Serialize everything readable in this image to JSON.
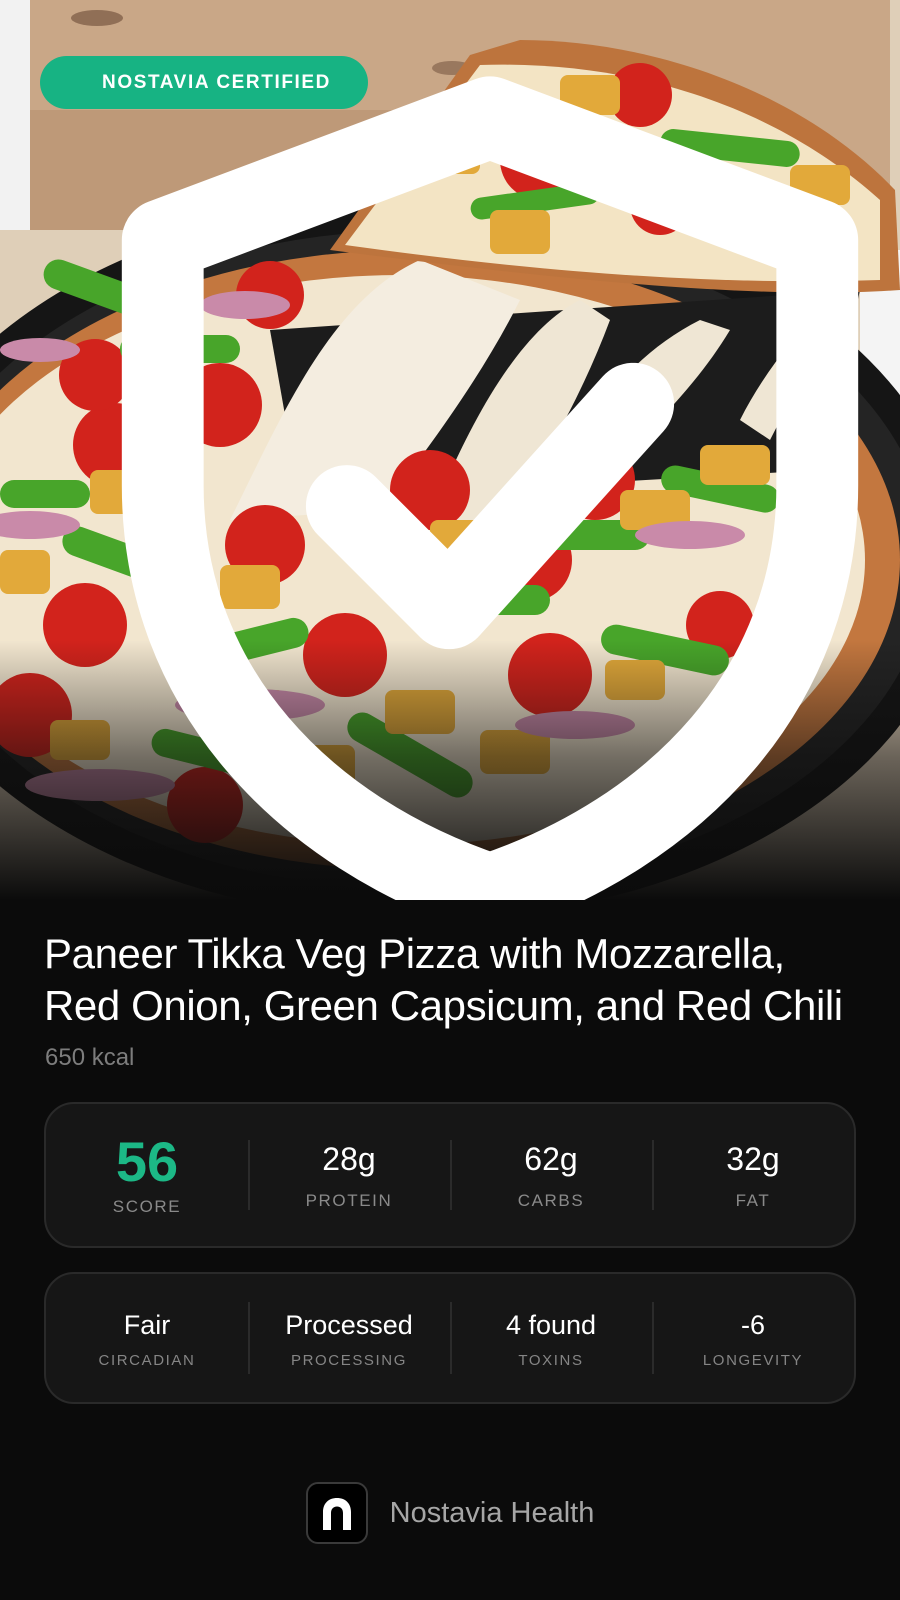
{
  "badge": {
    "label": "NOSTAVIA CERTIFIED",
    "icon": "shield-check-icon",
    "color": "#17b383"
  },
  "meal": {
    "title": "Paneer Tikka Veg Pizza with Mozzarella, Red Onion, Green Capsicum, and Red Chili",
    "calories": "650 kcal"
  },
  "macros": {
    "score": {
      "value": "56",
      "label": "SCORE",
      "color": "#1cb886"
    },
    "protein": {
      "value": "28g",
      "label": "PROTEIN"
    },
    "carbs": {
      "value": "62g",
      "label": "CARBS"
    },
    "fat": {
      "value": "32g",
      "label": "FAT"
    }
  },
  "health": {
    "circadian": {
      "value": "Fair",
      "label": "CIRCADIAN"
    },
    "processing": {
      "value": "Processed",
      "label": "PROCESSING"
    },
    "toxins": {
      "value": "4 found",
      "label": "TOXINS"
    },
    "longevity": {
      "value": "-6",
      "label": "LONGEVITY"
    }
  },
  "footer": {
    "brand": "Nostavia Health",
    "logo_icon": "arch-logo-icon"
  }
}
